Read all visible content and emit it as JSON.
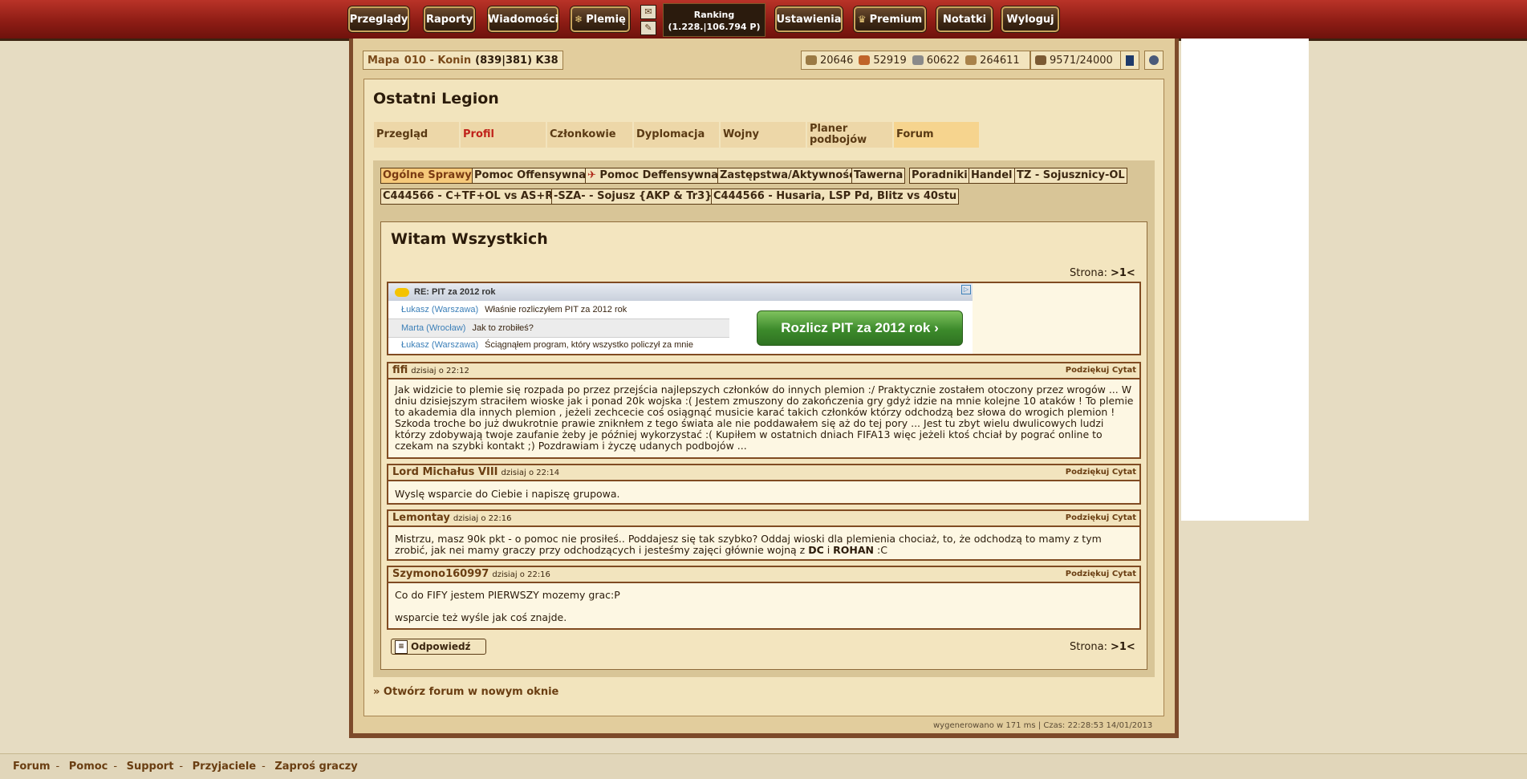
{
  "topnav": {
    "items": [
      {
        "label": "Przeglądy",
        "icon": ""
      },
      {
        "label": "Raporty",
        "icon": ""
      },
      {
        "label": "Wiadomości",
        "icon": ""
      },
      {
        "label": "Plemię",
        "icon": "❄"
      },
      {
        "label": "Ustawienia",
        "icon": ""
      },
      {
        "label": "Premium",
        "icon": "♛"
      },
      {
        "label": "Notatki",
        "icon": ""
      },
      {
        "label": "Wyloguj",
        "icon": ""
      }
    ],
    "ranking_label": "Ranking",
    "ranking_value": "(1.228.|106.794 P)"
  },
  "village": {
    "map_label": "Mapa",
    "name": "010 - Konin",
    "coords": "(839|381) K38"
  },
  "resources": [
    {
      "value": "20646",
      "icon": "wood-icon",
      "color": "#9b7a45"
    },
    {
      "value": "52919",
      "icon": "clay-icon",
      "color": "#c0642a"
    },
    {
      "value": "60622",
      "icon": "iron-icon",
      "color": "#8a8a8a"
    },
    {
      "value": "264611",
      "icon": "storage-icon",
      "color": "#a9824a"
    }
  ],
  "population": "9571/24000",
  "tribe": {
    "title": "Ostatni Legion",
    "tabs": [
      "Przegląd",
      "Profil",
      "Członkowie",
      "Dyplomacja",
      "Wojny",
      "Planer podbojów",
      "Forum"
    ]
  },
  "forum": {
    "subtabs": [
      "Ogólne Sprawy",
      "Pomoc Offensywna",
      "Pomoc Deffensywna",
      "Zastępstwa/Aktywność",
      "Tawerna",
      "Poradniki",
      "Handel",
      "TZ - Sojusznicy-OL",
      "C444566 - C+TF+OL vs AS+R",
      "-SZA- - Sojusz {AKP & Tr3}",
      "C444566 - Husaria, LSP Pd, Blitz vs 40stu"
    ],
    "thread_title": "Witam Wszystkich",
    "pager_label": "Strona:",
    "pager_value": ">1<",
    "ad": {
      "subject": "RE: PIT za 2012 rok",
      "rows": [
        {
          "who": "Łukasz (Warszawa)",
          "text": "Właśnie rozliczyłem PIT za 2012 rok"
        },
        {
          "who": "Marta (Wrocław)",
          "text": "Jak to zrobiłeś?"
        },
        {
          "who": "Łukasz (Warszawa)",
          "text": "Ściągnąłem program, który wszystko policzył za mnie"
        }
      ],
      "cta": "Rozlicz PIT za 2012 rok ›"
    },
    "post_actions": "Podziękuj Cytat",
    "posts": [
      {
        "author": "fifi",
        "date": "dzisiaj o 22:12",
        "body": "Jak widzicie to plemie się rozpada po przez przejścia najlepszych członków do innych plemion :/ Praktycznie zostałem otoczony przez wrogów ... W dniu dzisiejszym straciłem wioske jak i ponad 20k wojska :( Jestem zmuszony do zakończenia gry gdyż idzie na mnie kolejne 10 ataków ! To plemie to akademia dla innych plemion , jeżeli zechcecie coś osiągnąć musicie karać takich członków którzy odchodzą bez słowa do wrogich plemion ! Szkoda troche bo już dwukrotnie prawie zniknłem z tego świata ale nie poddawałem się aż do tej pory ... Jest tu zbyt wielu dwulicowych ludzi którzy zdobywają twoje zaufanie żeby je później wykorzystać :( Kupiłem w ostatnich dniach FIFA13 więc jeżeli ktoś chciał by pograć online to czekam na szybki kontakt ;) Pozdrawiam i życzę udanych podbojów ..."
      },
      {
        "author": "Lord Michałus VIII",
        "date": "dzisiaj o 22:14",
        "body": "Wyslę wsparcie do Ciebie i napiszę grupowa."
      },
      {
        "author": "Lemontay",
        "date": "dzisiaj o 22:16",
        "body_pre": "Mistrzu, masz 90k pkt - o pomoc nie prosiłeś.. Poddajesz się tak szybko? Oddaj wioski dla plemienia chociaż, to, że odchodzą to mamy z tym zrobić, jak nei mamy graczy przy odchodzących i jesteśmy zajęci głównie wojną z ",
        "b1": "DC",
        "mid": " i ",
        "b2": "ROHAN",
        "post": " :C"
      },
      {
        "author": "Szymono160997",
        "date": "dzisiaj o 22:16",
        "line1": "Co do FIFY jestem PIERWSZY mozemy grac:P",
        "line2": "wsparcie też wyśle jak coś znajde."
      }
    ],
    "reply_label": "Odpowiedź",
    "open_forum": "» Otwórz forum w nowym oknie"
  },
  "generated": "wygenerowano w 171 ms | Czas: 22:28:53 14/01/2013",
  "footer": [
    "Forum",
    "Pomoc",
    "Support",
    "Przyjaciele",
    "Zaproś graczy"
  ]
}
